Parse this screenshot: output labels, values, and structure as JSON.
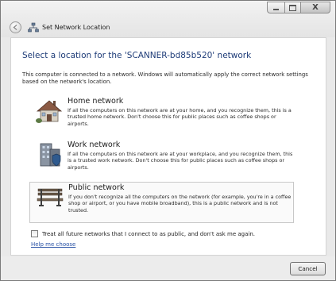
{
  "window": {
    "title": "Set Network Location",
    "caption_close": "X"
  },
  "main": {
    "heading": "Select a location for the 'SCANNER-bd85b520' network",
    "intro": "This computer is connected to a network. Windows will automatically apply the correct network settings based on the network's location.",
    "options": [
      {
        "title": "Home network",
        "icon": "house-icon",
        "description": "If all the computers on this network are at your home, and you recognize them, this is a trusted home network.  Don't choose this for public places such as coffee shops or airports."
      },
      {
        "title": "Work network",
        "icon": "office-building-icon",
        "description": "If all the computers on this network are at your workplace, and you recognize them, this is a trusted work network.  Don't choose this for public places such as coffee shops or airports."
      },
      {
        "title": "Public network",
        "icon": "park-bench-icon",
        "description": "If you don't recognize all the computers on the network (for example, you're in a coffee shop or airport, or you have mobile broadband), this is a public network and is not trusted."
      }
    ],
    "checkbox_label": "Treat all future networks that I connect to as public, and don't ask me again.",
    "checkbox_checked": false,
    "help_link": "Help me choose"
  },
  "footer": {
    "cancel_label": "Cancel"
  }
}
